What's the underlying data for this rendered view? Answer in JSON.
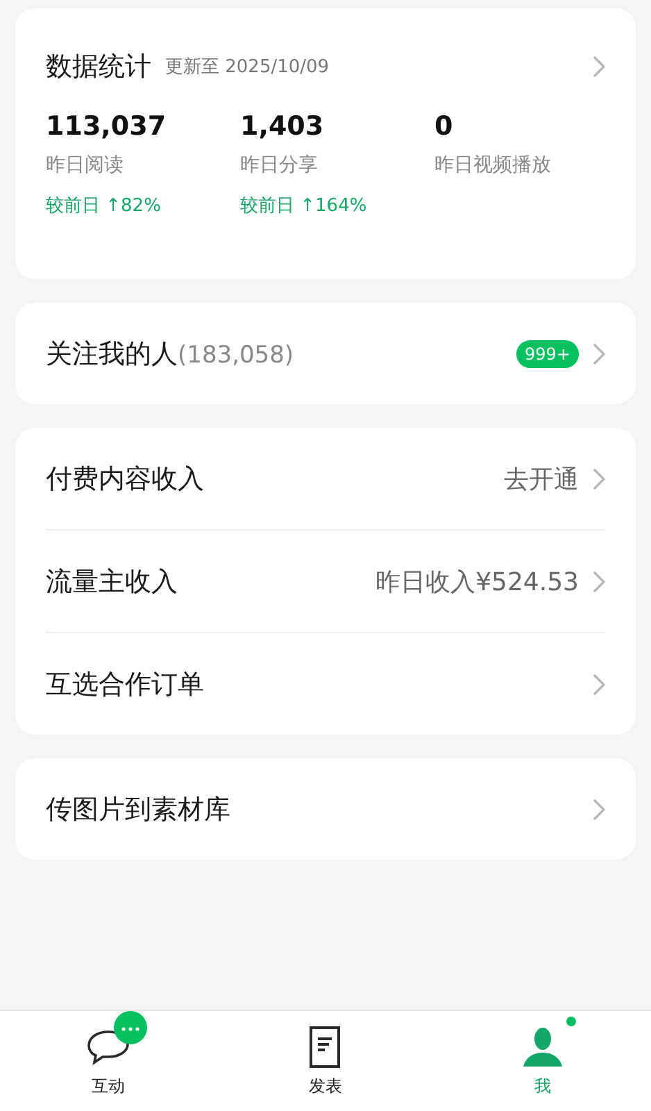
{
  "stats": {
    "title": "数据统计",
    "updated": "更新至 2025/10/09",
    "items": [
      {
        "value": "113,037",
        "label": "昨日阅读",
        "change": "较前日 ↑82%"
      },
      {
        "value": "1,403",
        "label": "昨日分享",
        "change": "较前日 ↑164%"
      },
      {
        "value": "0",
        "label": "昨日视频播放"
      }
    ]
  },
  "sections": [
    [
      {
        "label": "关注我的人",
        "count": "(183,058)",
        "badge": "999+"
      }
    ],
    [
      {
        "label": "付费内容收入",
        "value": "去开通"
      },
      {
        "label": "流量主收入",
        "value": "昨日收入¥524.53"
      },
      {
        "label": "互选合作订单"
      }
    ],
    [
      {
        "label": "传图片到素材库"
      }
    ]
  ],
  "tabs": [
    {
      "label": "互动",
      "kind": "chat",
      "selected": false,
      "unread": true
    },
    {
      "label": "发表",
      "kind": "doc",
      "selected": false,
      "unread": false
    },
    {
      "label": "我",
      "kind": "person",
      "selected": true,
      "unread": true
    }
  ]
}
